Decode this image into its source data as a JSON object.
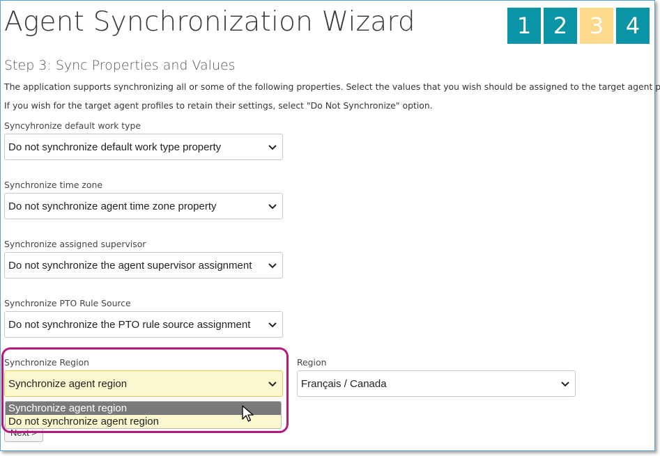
{
  "wizard": {
    "title": "Agent Synchronization Wizard",
    "steps": [
      {
        "label": "1",
        "state": "done"
      },
      {
        "label": "2",
        "state": "done"
      },
      {
        "label": "3",
        "state": "active"
      },
      {
        "label": "4",
        "state": "pending"
      }
    ],
    "colors": {
      "step_done": "#0b93a6",
      "step_active": "#fcd98c",
      "highlight": "#b5177f",
      "selected_bg": "#fbf8cf"
    }
  },
  "step": {
    "subtitle": "Step 3: Sync Properties and Values",
    "desc1": "The application supports synchronizing all or some of the following properties. Select the values that you wish should be assigned to the target agent profiles,",
    "desc2": "If you wish for the target agent profiles to retain their settings, select \"Do Not Synchronize\" option."
  },
  "fields": {
    "work_type": {
      "label": "Syncyhronize default work type",
      "value": "Do not synchronize default work type property"
    },
    "time_zone": {
      "label": "Synchronize time zone",
      "value": "Do not synchronize agent time zone property"
    },
    "supervisor": {
      "label": "Synchronize assigned supervisor",
      "value": "Do not synchronize the agent supervisor assignment"
    },
    "pto": {
      "label": "Synchronize PTO Rule Source",
      "value": "Do not synchronize the PTO rule source assignment"
    },
    "region_sync": {
      "label": "Synchronize Region",
      "value": "Synchronize agent region",
      "options": [
        "Synchronize agent region",
        "Do not synchronize agent region"
      ]
    },
    "region": {
      "label": "Region",
      "value": "Français / Canada"
    }
  },
  "buttons": {
    "next": "Next >"
  }
}
